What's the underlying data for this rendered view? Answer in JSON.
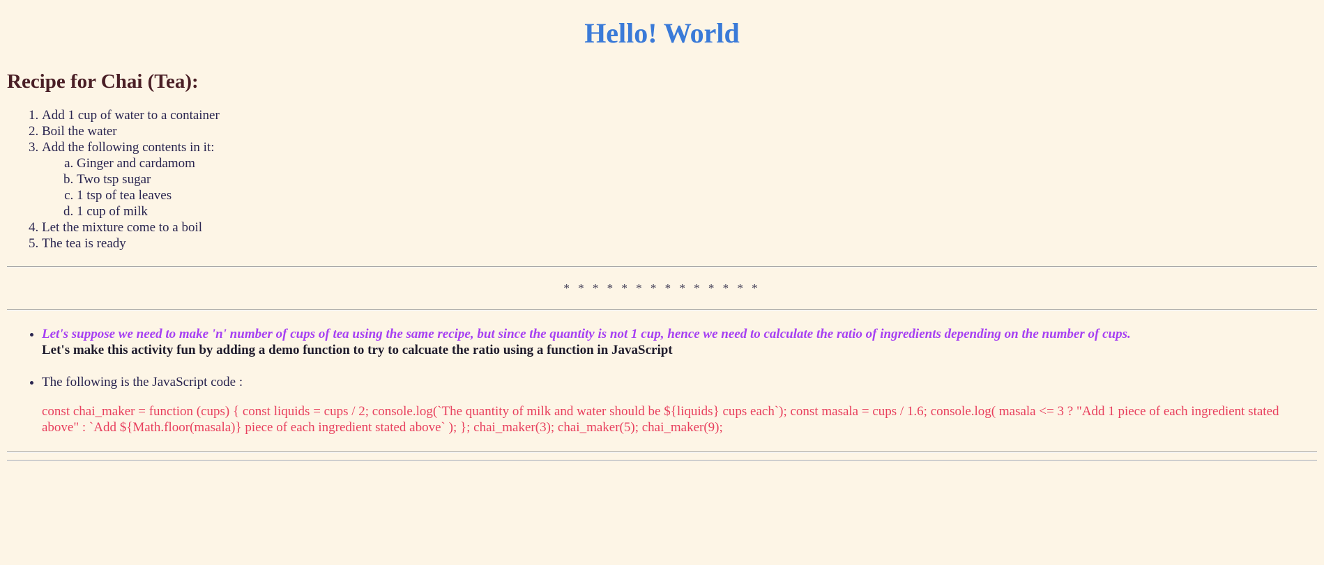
{
  "heading": "Hello! World",
  "recipe_title": "Recipe for Chai (Tea):",
  "steps": [
    "Add 1 cup of water to a container",
    "Boil the water",
    "Add the following contents in it:",
    "Let the mixture come to a boil",
    "The tea is ready"
  ],
  "sub_steps": [
    "Ginger and cardamom",
    "Two tsp sugar",
    "1 tsp of tea leaves",
    "1 cup of milk"
  ],
  "stars": "* * * * * * * * * * * * * *",
  "note1_italic": "Let's suppose we need to make 'n' number of cups of tea using the same recipe, but since the quantity is not 1 cup, hence we need to calculate the ratio of ingredients depending on the number of cups.",
  "note1_bold": "Let's make this activity fun by adding a demo function to try to calcuate the ratio using a function in JavaScript",
  "note2_text": "The following is the JavaScript code :",
  "code": "const chai_maker = function (cups) { const liquids = cups / 2; console.log(`The quantity of milk and water should be ${liquids} cups each`); const masala = cups / 1.6; console.log( masala <= 3 ? \"Add 1 piece of each ingredient stated above\" : `Add ${Math.floor(masala)} piece of each ingredient stated above` ); }; chai_maker(3); chai_maker(5); chai_maker(9);",
  "colors": {
    "background": "#fdf5e6",
    "heading": "#3a7ad8",
    "recipe_title": "#4a1f26",
    "italic_note": "#a640f2",
    "code": "#e8405e"
  }
}
